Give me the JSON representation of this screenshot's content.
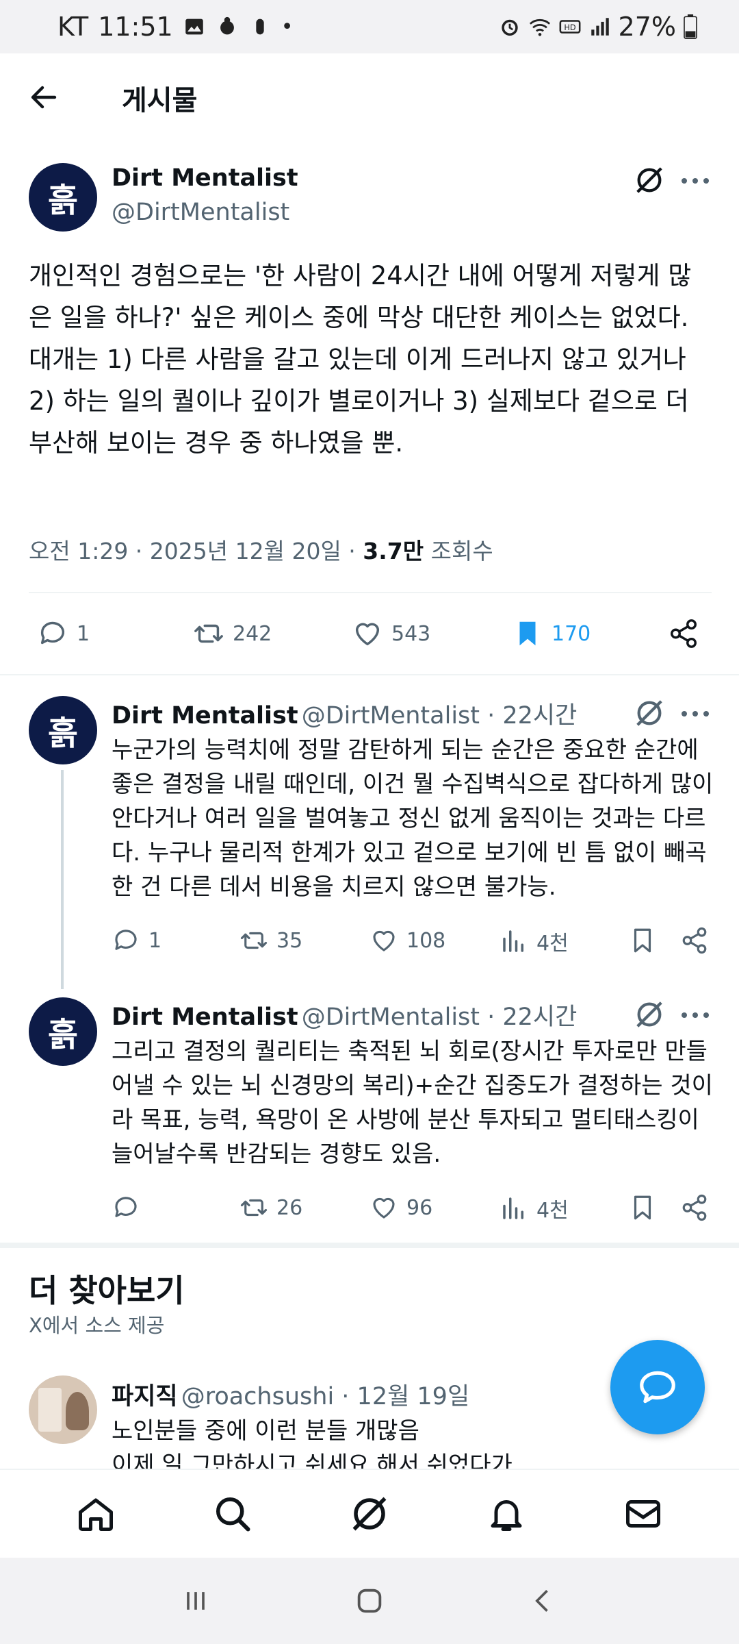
{
  "status_bar": {
    "carrier": "KT",
    "time": "11:51",
    "battery": "27%"
  },
  "header": {
    "title": "게시물"
  },
  "post": {
    "author_name": "Dirt Mentalist",
    "author_handle": "@DirtMentalist",
    "avatar_text": "흙",
    "text": "개인적인 경험으로는 '한 사람이 24시간 내에 어떻게 저렇게 많은 일을 하나?' 싶은 케이스 중에 막상 대단한 케이스는 없었다.\n대개는 1) 다른 사람을 갈고 있는데 이게 드러나지 않고 있거나 2) 하는 일의 퀄이나 깊이가 별로이거나 3) 실제보다 겉으로 더 부산해 보이는 경우 중 하나였을 뿐.",
    "timestamp": "오전 1:29 · 2025년 12월 20일 · ",
    "views": "3.7만",
    "views_label": " 조회수",
    "replies": "1",
    "reposts": "242",
    "likes": "543",
    "bookmarks": "170"
  },
  "replies": [
    {
      "author_name": "Dirt Mentalist",
      "author_handle": "@DirtMentalist · 22시간",
      "text": "누군가의 능력치에 정말 감탄하게 되는 순간은 중요한 순간에 좋은 결정을 내릴 때인데, 이건 뭘 수집벽식으로 잡다하게 많이 안다거나 여러 일을 벌여놓고 정신 없게 움직이는 것과는 다르다. 누구나 물리적 한계가 있고 겉으로 보기에 빈 틈 없이 빼곡한 건 다른 데서 비용을 치르지 않으면 불가능.",
      "replies": "1",
      "reposts": "35",
      "likes": "108",
      "views": "4천"
    },
    {
      "author_name": "Dirt Mentalist",
      "author_handle": "@DirtMentalist · 22시간",
      "text": "그리고 결정의 퀄리티는 축적된 뇌 회로(장시간 투자로만 만들어낼 수 있는 뇌 신경망의 복리)+순간 집중도가 결정하는 것이라 목표, 능력, 욕망이 온 사방에 분산 투자되고 멀티태스킹이 늘어날수록 반감되는 경향도 있음.",
      "replies": "",
      "reposts": "26",
      "likes": "96",
      "views": "4천"
    }
  ],
  "discover": {
    "title": "더 찾아보기",
    "subtitle": "X에서 소스 제공",
    "item": {
      "author_name": "파지직",
      "author_handle": "@roachsushi · 12월 19일",
      "line1": "노인분들 중에 이런 분들 개많음",
      "line2": "이제 일 그만하시고 쉬세요 해서 쉬었다가"
    }
  }
}
